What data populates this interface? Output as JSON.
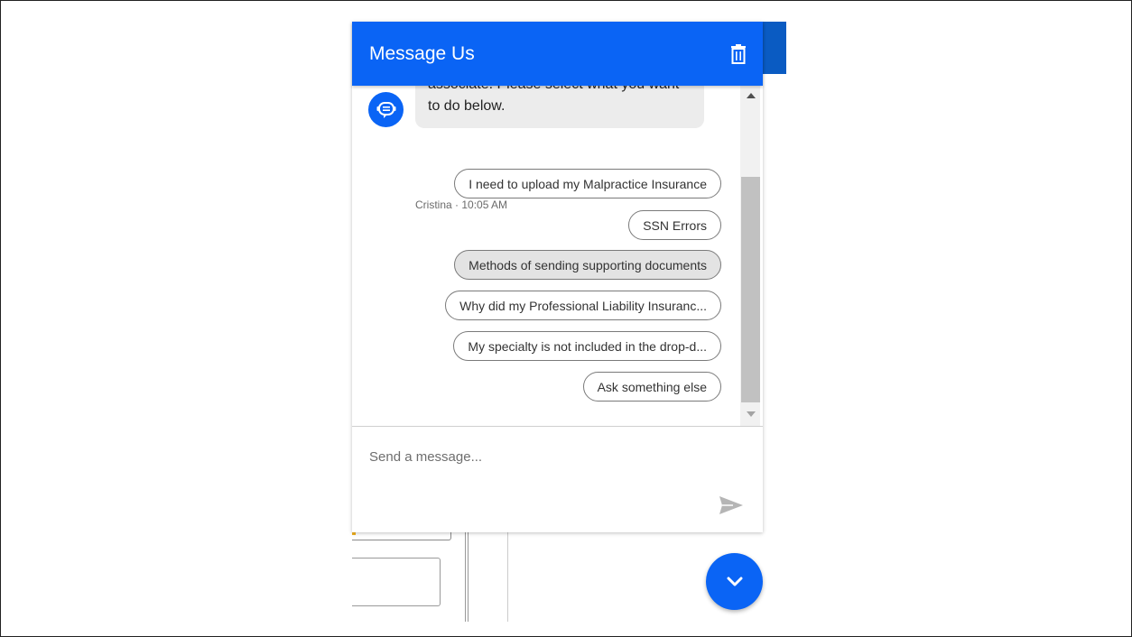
{
  "header": {
    "title": "Message Us",
    "delete_icon": "trash-icon"
  },
  "conversation": {
    "bot_avatar_icon": "chat-bot-icon",
    "bot_message": {
      "line1": "associate.  Please select what you want",
      "line2": "to do below."
    },
    "meta": "Cristina · 10:05 AM",
    "quick_replies": [
      {
        "label": "I need to upload my Malpractice Insurance",
        "active": false
      },
      {
        "label": "SSN Errors",
        "active": false
      },
      {
        "label": "Methods of sending supporting documents",
        "active": true
      },
      {
        "label": "Why did my Professional Liability Insuranc...",
        "active": false
      },
      {
        "label": "My specialty is not included in the drop-d...",
        "active": false
      },
      {
        "label": "Ask something else",
        "active": false
      }
    ]
  },
  "composer": {
    "placeholder": "Send a message...",
    "send_icon": "send-icon"
  },
  "minimize_button": {
    "icon": "chevron-down-icon"
  },
  "colors": {
    "brand": "#0a64f5",
    "chip_active": "#e3e3e3",
    "bubble": "#ececec"
  }
}
